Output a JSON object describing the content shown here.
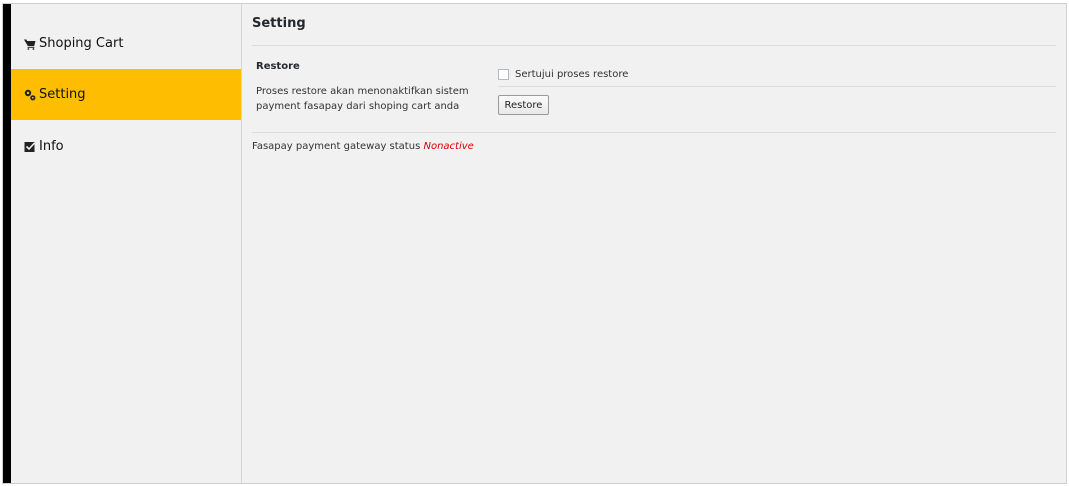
{
  "sidebar": {
    "items": [
      {
        "label": "Shoping Cart",
        "icon": "cart-icon",
        "active": false
      },
      {
        "label": "Setting",
        "icon": "gears-icon",
        "active": true
      },
      {
        "label": "Info",
        "icon": "checkbox-icon",
        "active": false
      }
    ]
  },
  "main": {
    "title": "Setting",
    "restore": {
      "label": "Restore",
      "description": "Proses restore akan menonaktifkan sistem payment fasapay dari shoping cart anda",
      "agree_label": "Sertujui proses restore",
      "agree_checked": false,
      "button_label": "Restore"
    },
    "status": {
      "text": "Fasapay payment gateway status",
      "value": "Nonactive"
    }
  },
  "colors": {
    "active_nav": "#ffbd00",
    "status_value": "#dc0000",
    "background": "#f1f1f1"
  }
}
